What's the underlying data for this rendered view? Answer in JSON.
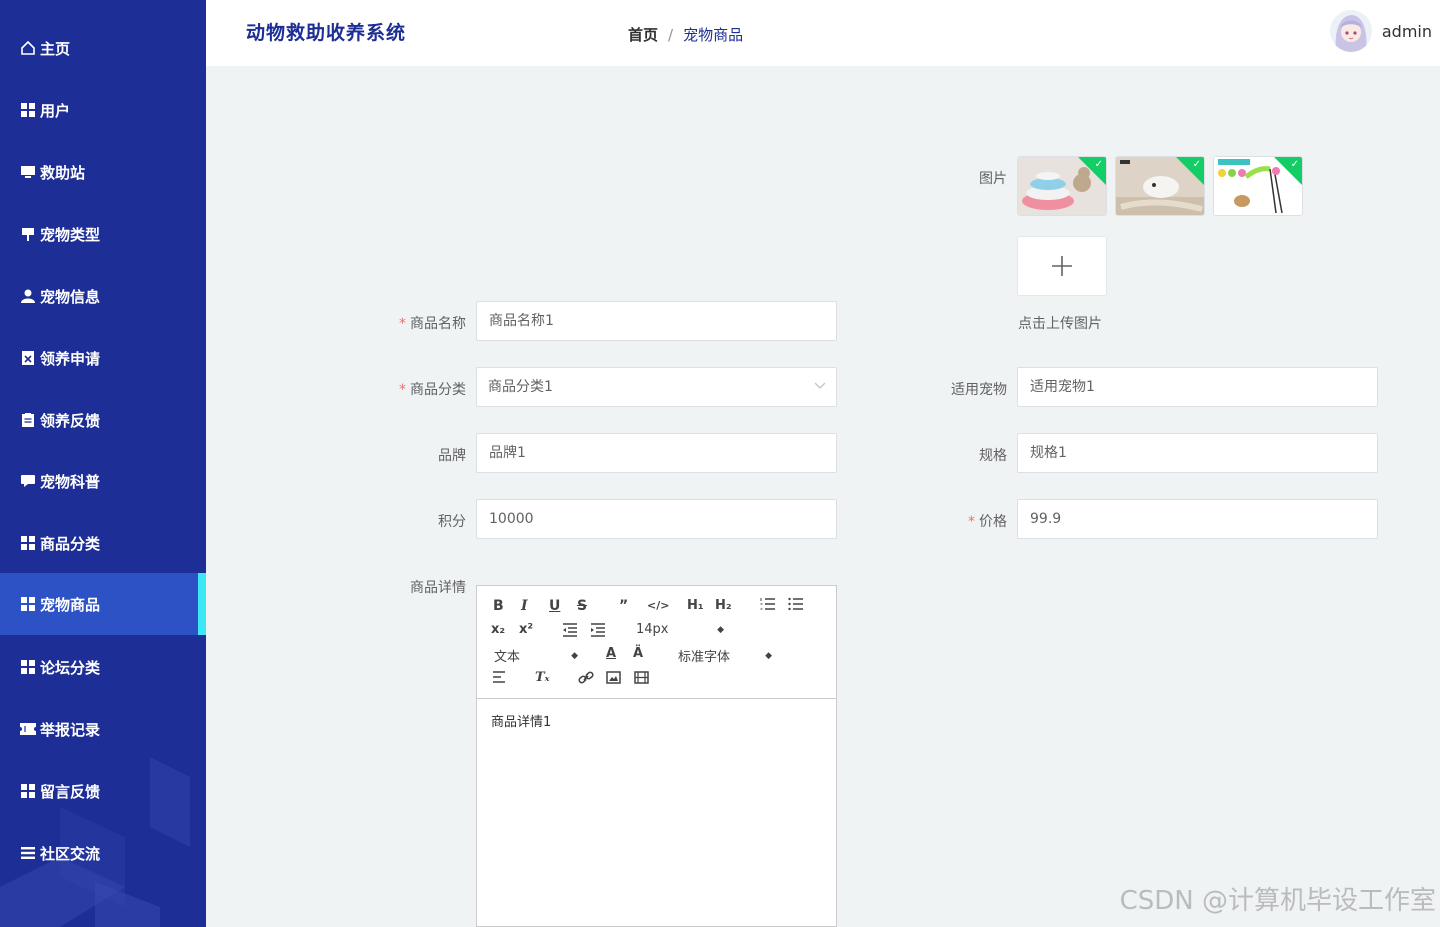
{
  "header": {
    "app_title": "动物救助收养系统",
    "breadcrumb_home": "首页",
    "breadcrumb_sep": "/",
    "breadcrumb_current": "宠物商品",
    "username": "admin"
  },
  "sidebar": {
    "items": [
      {
        "label": "主页",
        "icon": "home-icon"
      },
      {
        "label": "用户",
        "icon": "grid-icon"
      },
      {
        "label": "救助站",
        "icon": "monitor-icon"
      },
      {
        "label": "宠物类型",
        "icon": "signpost-icon"
      },
      {
        "label": "宠物信息",
        "icon": "user-icon"
      },
      {
        "label": "领养申请",
        "icon": "document-x-icon"
      },
      {
        "label": "领养反馈",
        "icon": "clipboard-icon"
      },
      {
        "label": "宠物科普",
        "icon": "chat-icon"
      },
      {
        "label": "商品分类",
        "icon": "grid-icon"
      },
      {
        "label": "宠物商品",
        "icon": "grid-icon",
        "active": true
      },
      {
        "label": "论坛分类",
        "icon": "grid-icon"
      },
      {
        "label": "举报记录",
        "icon": "ticket-icon"
      },
      {
        "label": "留言反馈",
        "icon": "grid-icon"
      },
      {
        "label": "社区交流",
        "icon": "list-icon"
      }
    ],
    "active_color": "#2d52c6",
    "active_indicator_color": "#3de8f6",
    "bg_color": "#1d2e96"
  },
  "form": {
    "images_label": "图片",
    "upload_tip": "点击上传图片",
    "name_label": "商品名称",
    "name_value": "商品名称1",
    "category_label": "商品分类",
    "category_value": "商品分类1",
    "suitable_label": "适用宠物",
    "suitable_value": "适用宠物1",
    "brand_label": "品牌",
    "brand_value": "品牌1",
    "spec_label": "规格",
    "spec_value": "规格1",
    "points_label": "积分",
    "points_value": "10000",
    "price_label": "价格",
    "price_value": "99.9",
    "detail_label": "商品详情",
    "required_mark": "*"
  },
  "editor": {
    "font_size": "14px",
    "text_type": "文本",
    "font_family": "标准字体",
    "content": "商品详情1"
  },
  "watermark": "CSDN @计算机毕设工作室"
}
